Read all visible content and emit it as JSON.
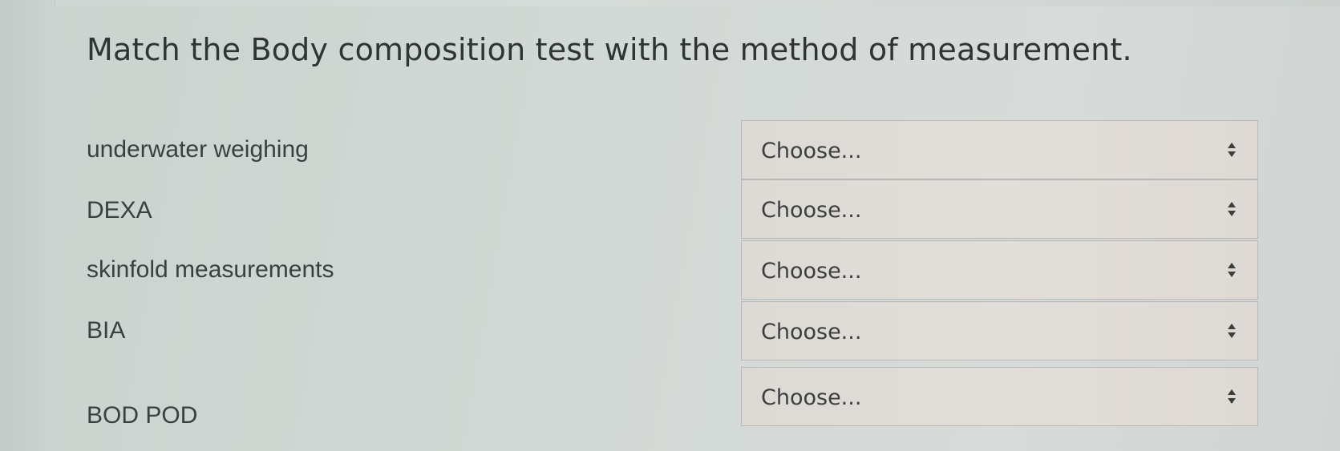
{
  "question": {
    "title": "Match the Body composition test with the method of measurement."
  },
  "rows": [
    {
      "label": "underwater weighing",
      "selected": "Choose..."
    },
    {
      "label": "DEXA",
      "selected": "Choose..."
    },
    {
      "label": "skinfold measurements",
      "selected": "Choose..."
    },
    {
      "label": "BIA",
      "selected": "Choose..."
    },
    {
      "label": "BOD POD",
      "selected": "Choose..."
    }
  ],
  "icons": {
    "select_indicator": "up-down-arrows-icon"
  }
}
